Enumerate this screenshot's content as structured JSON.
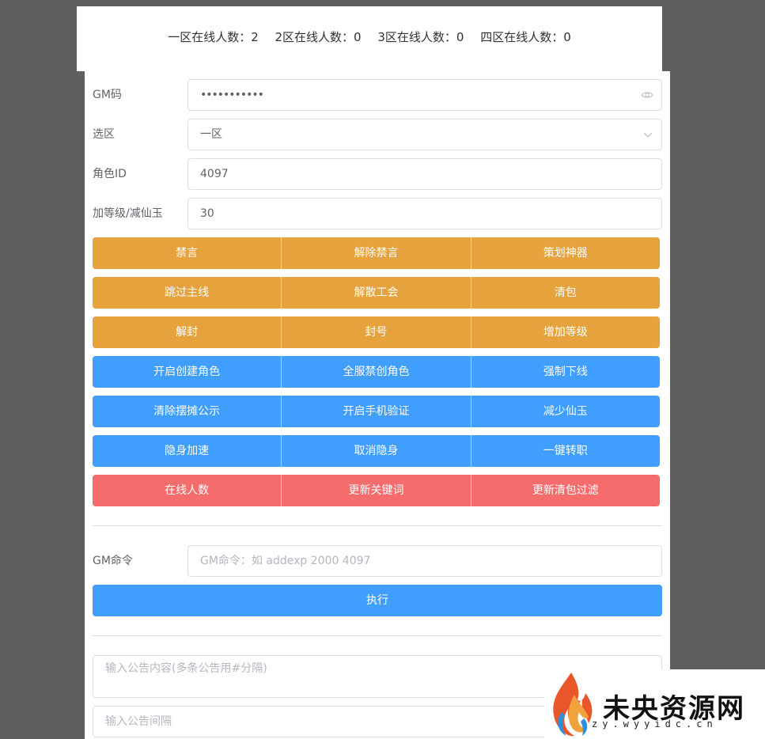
{
  "online_stats": [
    "一区在线人数：2",
    "2区在线人数：0",
    "3区在线人数：0",
    "四区在线人数：0"
  ],
  "form": {
    "gm_code": {
      "label": "GM码",
      "value": "•••••••••••",
      "suffix_icon": "eye-icon"
    },
    "zone": {
      "label": "选区",
      "value": "一区",
      "suffix_icon": "chevron-down-icon"
    },
    "role_id": {
      "label": "角色ID",
      "value": "4097"
    },
    "level_jade": {
      "label": "加等级/减仙玉",
      "value": "30"
    }
  },
  "button_groups": [
    {
      "style": "orange",
      "color": "#e6a23c",
      "buttons": [
        "禁言",
        "解除禁言",
        "策划神器"
      ]
    },
    {
      "style": "orange",
      "color": "#e6a23c",
      "buttons": [
        "跳过主线",
        "解散工会",
        "清包"
      ]
    },
    {
      "style": "orange",
      "color": "#e6a23c",
      "buttons": [
        "解封",
        "封号",
        "增加等级"
      ]
    },
    {
      "style": "blue",
      "color": "#409eff",
      "buttons": [
        "开启创建角色",
        "全服禁创角色",
        "强制下线"
      ]
    },
    {
      "style": "blue",
      "color": "#409eff",
      "buttons": [
        "清除摆摊公示",
        "开启手机验证",
        "减少仙玉"
      ]
    },
    {
      "style": "blue",
      "color": "#409eff",
      "buttons": [
        "隐身加速",
        "取消隐身",
        "一键转职"
      ]
    },
    {
      "style": "red",
      "color": "#f56c6c",
      "buttons": [
        "在线人数",
        "更新关键词",
        "更新清包过滤"
      ]
    }
  ],
  "gm_command": {
    "label": "GM命令",
    "placeholder": "GM命令：如 addexp 2000 4097",
    "execute_label": "执行"
  },
  "announcement": {
    "content_placeholder": "输入公告内容(多条公告用#分隔)",
    "interval_placeholder": "输入公告间隔"
  },
  "watermark": {
    "title": "未央资源网",
    "url": "zy.wyyidc.cn"
  }
}
